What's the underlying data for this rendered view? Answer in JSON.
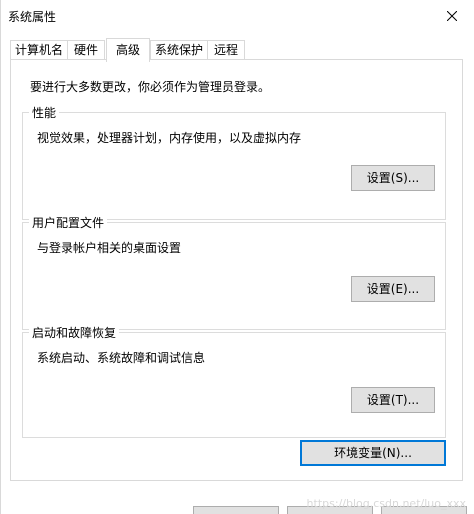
{
  "window": {
    "title": "系统属性"
  },
  "tabs": [
    {
      "label": "计算机名",
      "active": false
    },
    {
      "label": "硬件",
      "active": false
    },
    {
      "label": "高级",
      "active": true
    },
    {
      "label": "系统保护",
      "active": false
    },
    {
      "label": "远程",
      "active": false
    }
  ],
  "advanced": {
    "admin_note": "要进行大多数更改，你必须作为管理员登录。",
    "performance": {
      "title": "性能",
      "description": "视觉效果，处理器计划，内存使用，以及虚拟内存",
      "button": "设置(S)..."
    },
    "user_profiles": {
      "title": "用户配置文件",
      "description": "与登录帐户相关的桌面设置",
      "button": "设置(E)..."
    },
    "startup_recovery": {
      "title": "启动和故障恢复",
      "description": "系统启动、系统故障和调试信息",
      "button": "设置(T)..."
    },
    "env_vars_button": "环境变量(N)..."
  },
  "watermark": "https://blog.csdn.net/luo_xxx",
  "colors": {
    "button_face": "#e1e1e1",
    "button_border": "#adadad",
    "focus_border": "#0078d7",
    "group_border": "#dcdcdc"
  },
  "icons": {
    "close": "close-icon"
  }
}
